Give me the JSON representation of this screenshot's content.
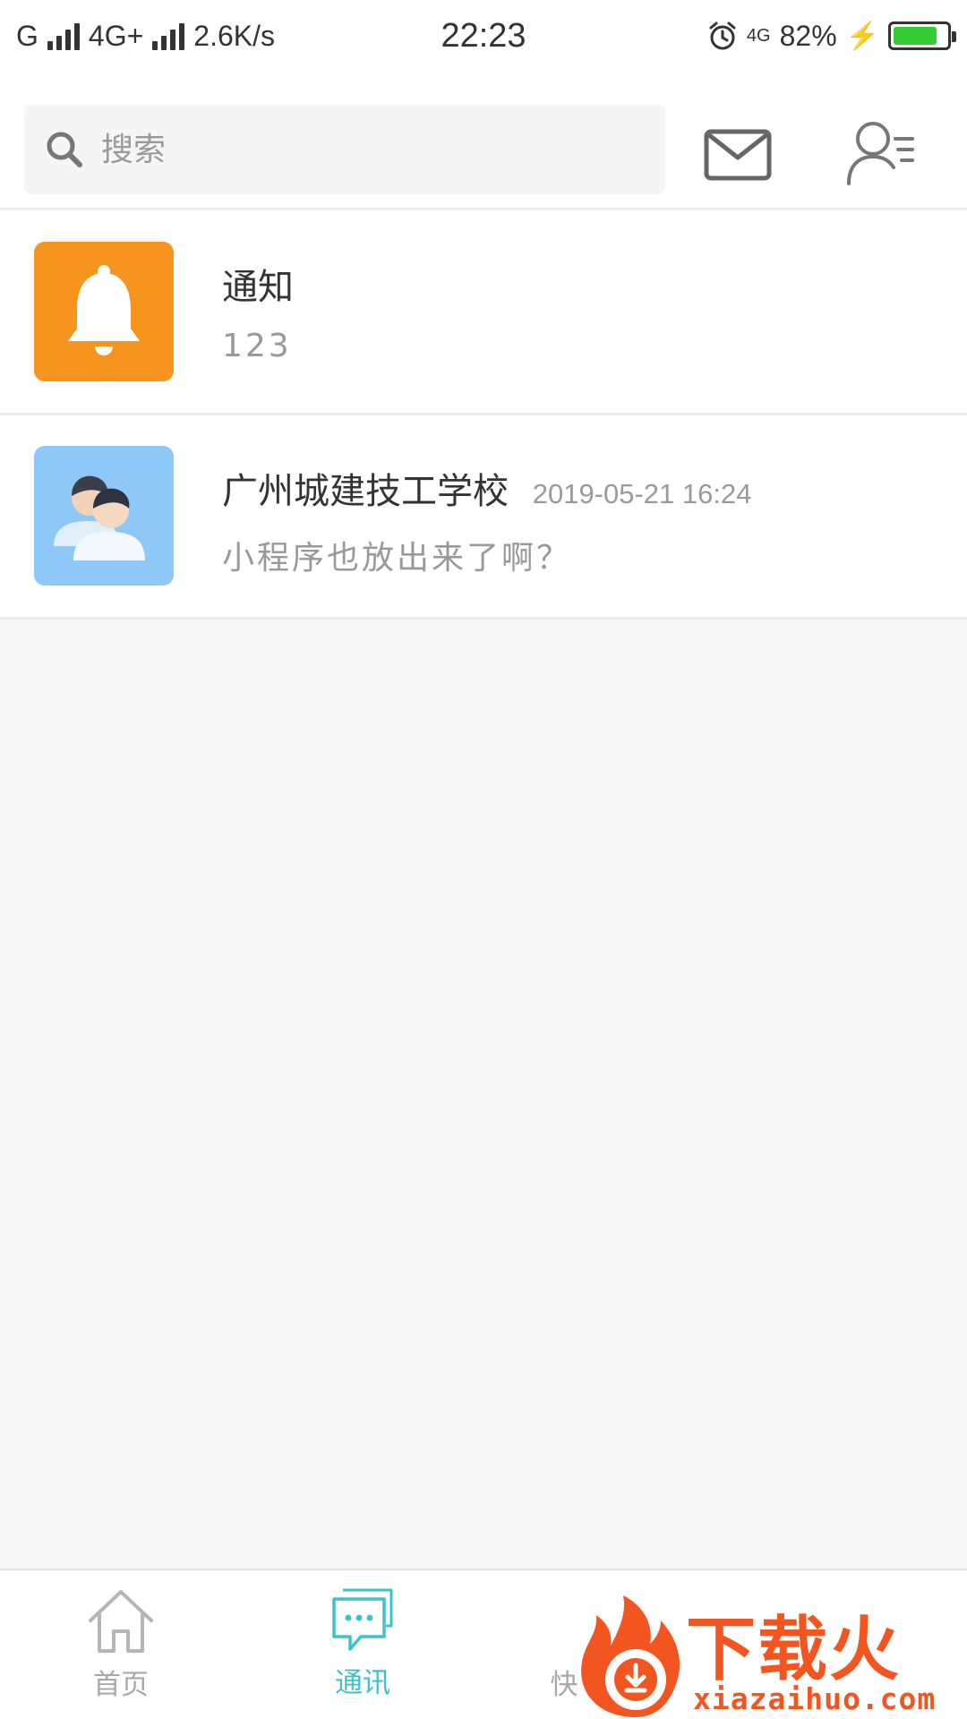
{
  "status_bar": {
    "carrier1": "G",
    "carrier2": "4G+",
    "speed": "2.6K/s",
    "time": "22:23",
    "net_badge": "4G",
    "battery": "82%",
    "battery_level": 0.82,
    "battery_color": "#33cc33"
  },
  "header": {
    "search_placeholder": "搜索",
    "icons": [
      "search-icon",
      "mail-icon",
      "contacts-icon"
    ]
  },
  "conversations": [
    {
      "title": "通知",
      "time": "",
      "preview": "123",
      "avatar": "bell-icon",
      "avatar_color": "#f7941e"
    },
    {
      "title": "广州城建技工学校",
      "time": "2019-05-21 16:24",
      "preview": "小程序也放出来了啊？",
      "avatar": "group-icon",
      "avatar_color": "#8ec8f9"
    }
  ],
  "tabbar": {
    "tabs": [
      {
        "label": "首页",
        "icon": "home-icon",
        "active": false
      },
      {
        "label": "通讯",
        "icon": "chat-icon",
        "active": true
      },
      {
        "label": "快",
        "icon": "",
        "active": false
      }
    ],
    "active_color": "#3fc2c6",
    "inactive_color": "#a8a8a8"
  },
  "watermark": {
    "title": "下载火",
    "url": "xiazaihuo.com",
    "color": "#f2551f"
  }
}
